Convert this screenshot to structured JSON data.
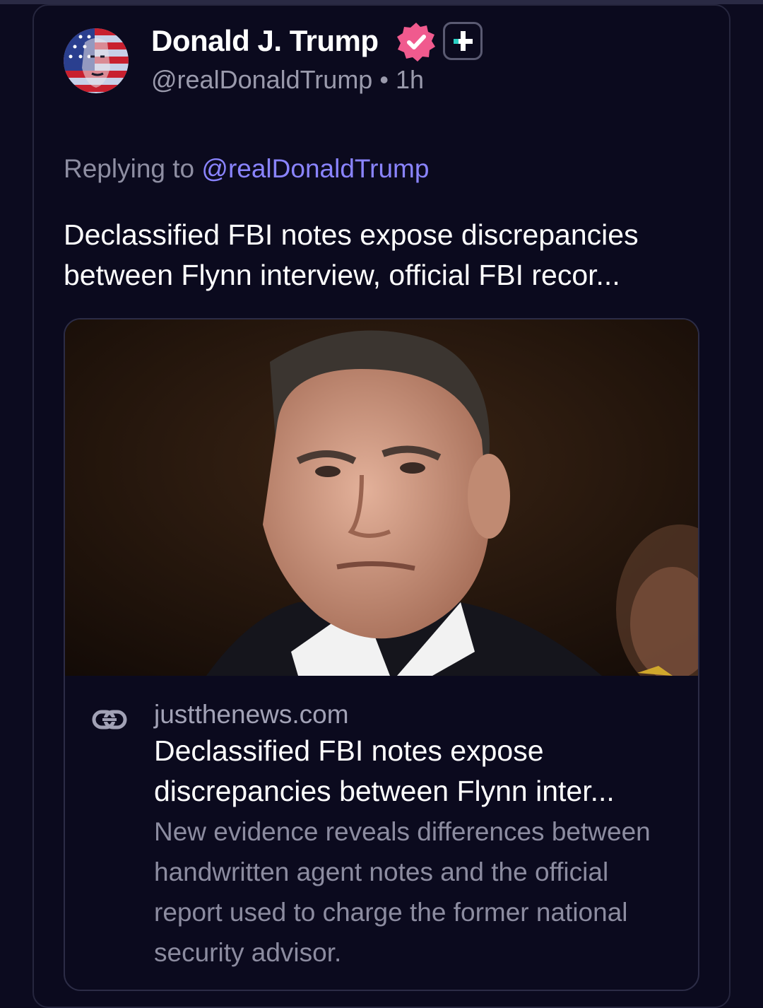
{
  "post": {
    "author": {
      "display_name": "Donald J. Trump",
      "handle": "@realDonaldTrump",
      "separator": "•",
      "timestamp": "1h",
      "avatar_icon": "flag-face-avatar",
      "verified_icon": "verified-check-badge-icon",
      "plus_icon": "plus-badge-icon"
    },
    "reply": {
      "prefix": "Replying to",
      "mention": "@realDonaldTrump"
    },
    "text": "Declassified FBI notes expose discrepancies between Flynn interview, official FBI recor...",
    "link_preview": {
      "domain": "justthenews.com",
      "title": "Declassified FBI notes expose discrepancies between Flynn inter...",
      "description": "New evidence reveals differences between handwritten agent notes and the official report used to charge the former national security advisor.",
      "image_icon": "article-photo",
      "link_icon": "link-chain-icon"
    }
  },
  "colors": {
    "background": "#0c0b1f",
    "mention": "#8a84ff",
    "verified_badge": "#f05a8e",
    "muted_text": "#9a9aac"
  }
}
